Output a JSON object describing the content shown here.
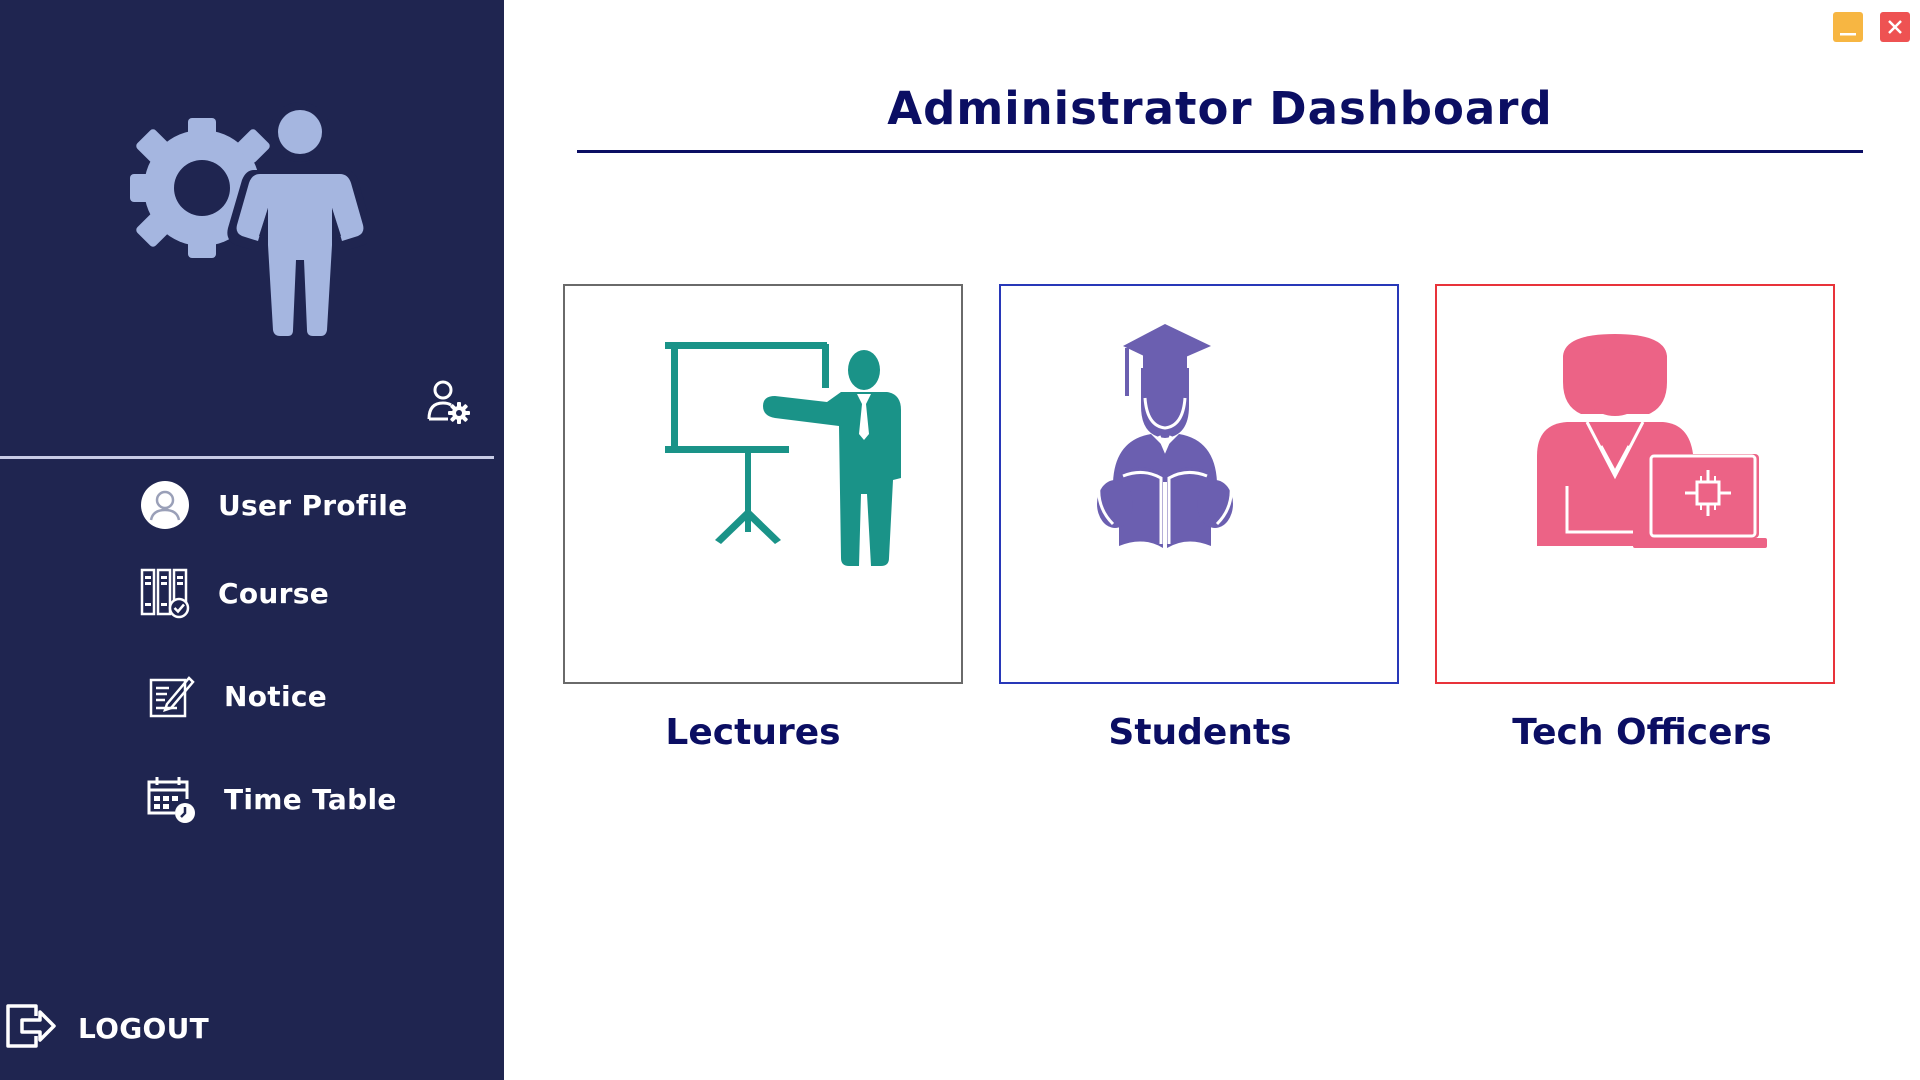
{
  "window": {
    "controls": {
      "minimize_color": "#f7b642",
      "close_color": "#ee5252"
    }
  },
  "sidebar": {
    "background": "#1f2550",
    "logo_icon": "admin-gear-person-icon",
    "settings_icon": "user-settings-icon",
    "items": [
      {
        "label": "User Profile",
        "icon": "user-avatar-icon"
      },
      {
        "label": "Course",
        "icon": "course-books-icon"
      },
      {
        "label": "Notice",
        "icon": "notice-edit-icon"
      },
      {
        "label": "Time Table",
        "icon": "calendar-clock-icon"
      }
    ],
    "logout": {
      "label": "LOGOUT",
      "icon": "logout-icon"
    }
  },
  "main": {
    "title": "Administrator Dashboard",
    "title_color": "#0b0e63",
    "cards": [
      {
        "label": "Lectures",
        "icon": "lecturer-whiteboard-icon",
        "color": "#1a9388",
        "border": "#6a6a6a"
      },
      {
        "label": "Students",
        "icon": "graduate-student-icon",
        "color": "#6b5fb0",
        "border": "#2838b8"
      },
      {
        "label": "Tech Officers",
        "icon": "tech-officer-icon",
        "color": "#ec6386",
        "border": "#e8333a"
      }
    ]
  }
}
